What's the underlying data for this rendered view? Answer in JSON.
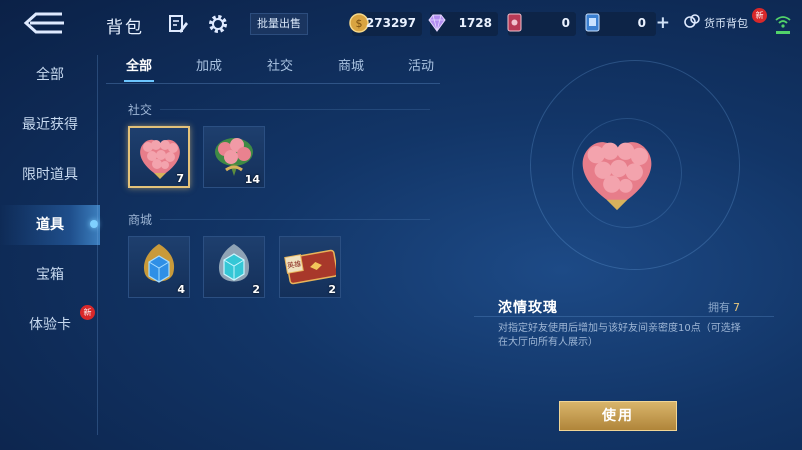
{
  "header": {
    "title": "背包",
    "bulk_sell_label": "批量出售",
    "wallet_label": "货币背包",
    "wallet_badge": "新",
    "currencies": [
      {
        "icon": "gold-coin-icon",
        "value": "273297"
      },
      {
        "icon": "diamond-icon",
        "value": "1728"
      },
      {
        "icon": "card-ticket-icon",
        "value": "0"
      },
      {
        "icon": "coupon-icon",
        "value": "0"
      }
    ]
  },
  "sidebar": {
    "items": [
      {
        "label": "全部"
      },
      {
        "label": "最近获得"
      },
      {
        "label": "限时道具"
      },
      {
        "label": "道具",
        "active": true
      },
      {
        "label": "宝箱"
      },
      {
        "label": "体验卡",
        "badge": "新"
      }
    ]
  },
  "tabs": [
    {
      "label": "全部",
      "active": true
    },
    {
      "label": "加成"
    },
    {
      "label": "社交"
    },
    {
      "label": "商城"
    },
    {
      "label": "活动"
    }
  ],
  "sections": [
    {
      "label": "社交",
      "items": [
        {
          "icon": "rose-heart-bouquet-icon",
          "count": "7",
          "selected": true
        },
        {
          "icon": "rose-bouquet-icon",
          "count": "14"
        }
      ]
    },
    {
      "label": "商城",
      "items": [
        {
          "icon": "blue-crystal-gold-icon",
          "count": "4"
        },
        {
          "icon": "cyan-crystal-icon",
          "count": "2"
        },
        {
          "icon": "hero-card-icon",
          "count": "2",
          "card_text": "英雄"
        }
      ]
    }
  ],
  "detail": {
    "name": "浓情玫瑰",
    "owned_label": "拥有",
    "owned_count": "7",
    "description": "对指定好友使用后增加与该好友间亲密度10点（可选择在大厅向所有人展示）",
    "use_label": "使用"
  },
  "colors": {
    "accent": "#6cc6ff",
    "gold": "#e3c27a",
    "badge_red": "#d8282a"
  }
}
